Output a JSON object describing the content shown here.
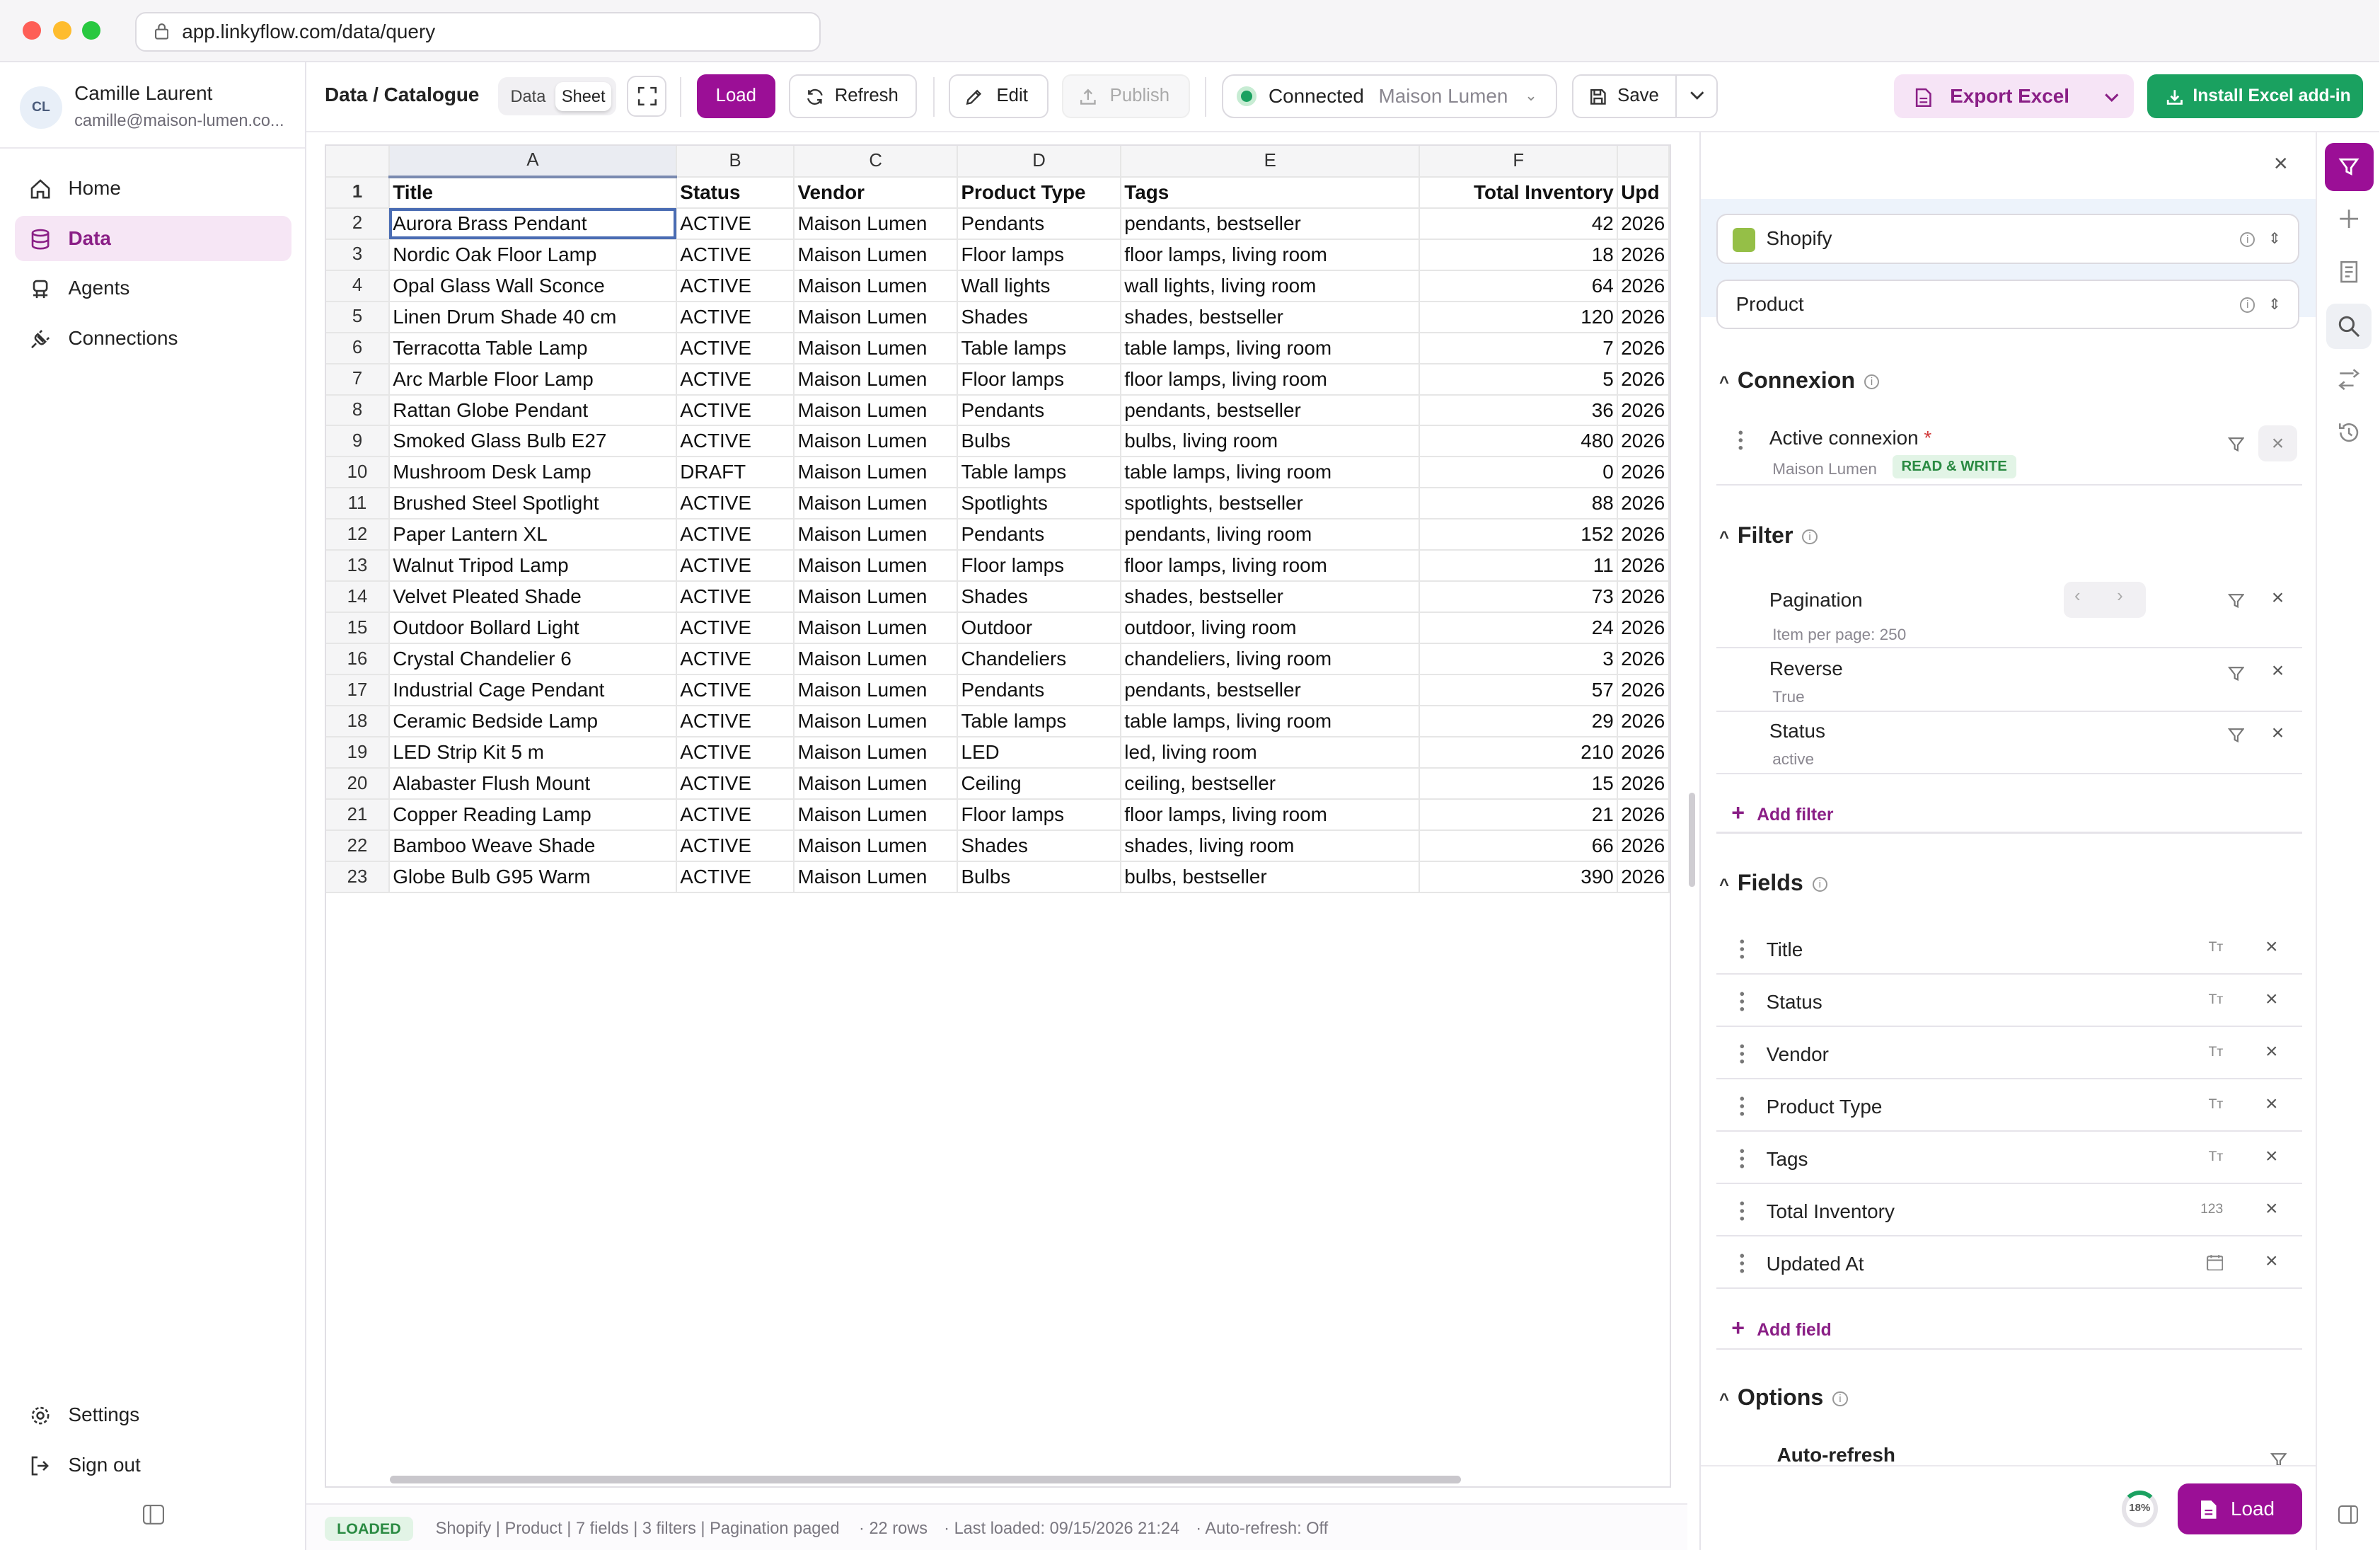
{
  "browser": {
    "url": "app.linkyflow.com/data/query"
  },
  "user": {
    "initials": "CL",
    "name": "Camille Laurent",
    "email": "camille@maison-lumen.co..."
  },
  "nav": {
    "home": "Home",
    "data": "Data",
    "agents": "Agents",
    "connections": "Connections",
    "settings": "Settings",
    "signout": "Sign out"
  },
  "toolbar": {
    "breadcrumb": "Data / Catalogue",
    "view_data": "Data",
    "view_sheet": "Sheet",
    "load": "Load",
    "refresh": "Refresh",
    "edit": "Edit",
    "publish": "Publish",
    "connection_status": "Connected",
    "connection_name": "Maison Lumen",
    "save": "Save",
    "export": "Export Excel",
    "install": "Install Excel add-in"
  },
  "sheet": {
    "columns": [
      "A",
      "B",
      "C",
      "D",
      "E",
      "F"
    ],
    "headers": [
      "Title",
      "Status",
      "Vendor",
      "Product Type",
      "Tags",
      "Total Inventory",
      "Upd"
    ],
    "rows": [
      [
        "Aurora Brass Pendant",
        "ACTIVE",
        "Maison Lumen",
        "Pendants",
        "pendants, bestseller",
        "42",
        "2026"
      ],
      [
        "Nordic Oak Floor Lamp",
        "ACTIVE",
        "Maison Lumen",
        "Floor lamps",
        "floor lamps, living room",
        "18",
        "2026"
      ],
      [
        "Opal Glass Wall Sconce",
        "ACTIVE",
        "Maison Lumen",
        "Wall lights",
        "wall lights, living room",
        "64",
        "2026"
      ],
      [
        "Linen Drum Shade 40 cm",
        "ACTIVE",
        "Maison Lumen",
        "Shades",
        "shades, bestseller",
        "120",
        "2026"
      ],
      [
        "Terracotta Table Lamp",
        "ACTIVE",
        "Maison Lumen",
        "Table lamps",
        "table lamps, living room",
        "7",
        "2026"
      ],
      [
        "Arc Marble Floor Lamp",
        "ACTIVE",
        "Maison Lumen",
        "Floor lamps",
        "floor lamps, living room",
        "5",
        "2026"
      ],
      [
        "Rattan Globe Pendant",
        "ACTIVE",
        "Maison Lumen",
        "Pendants",
        "pendants, bestseller",
        "36",
        "2026"
      ],
      [
        "Smoked Glass Bulb E27",
        "ACTIVE",
        "Maison Lumen",
        "Bulbs",
        "bulbs, living room",
        "480",
        "2026"
      ],
      [
        "Mushroom Desk Lamp",
        "DRAFT",
        "Maison Lumen",
        "Table lamps",
        "table lamps, living room",
        "0",
        "2026"
      ],
      [
        "Brushed Steel Spotlight",
        "ACTIVE",
        "Maison Lumen",
        "Spotlights",
        "spotlights, bestseller",
        "88",
        "2026"
      ],
      [
        "Paper Lantern XL",
        "ACTIVE",
        "Maison Lumen",
        "Pendants",
        "pendants, living room",
        "152",
        "2026"
      ],
      [
        "Walnut Tripod Lamp",
        "ACTIVE",
        "Maison Lumen",
        "Floor lamps",
        "floor lamps, living room",
        "11",
        "2026"
      ],
      [
        "Velvet Pleated Shade",
        "ACTIVE",
        "Maison Lumen",
        "Shades",
        "shades, bestseller",
        "73",
        "2026"
      ],
      [
        "Outdoor Bollard Light",
        "ACTIVE",
        "Maison Lumen",
        "Outdoor",
        "outdoor, living room",
        "24",
        "2026"
      ],
      [
        "Crystal Chandelier 6",
        "ACTIVE",
        "Maison Lumen",
        "Chandeliers",
        "chandeliers, living room",
        "3",
        "2026"
      ],
      [
        "Industrial Cage Pendant",
        "ACTIVE",
        "Maison Lumen",
        "Pendants",
        "pendants, bestseller",
        "57",
        "2026"
      ],
      [
        "Ceramic Bedside Lamp",
        "ACTIVE",
        "Maison Lumen",
        "Table lamps",
        "table lamps, living room",
        "29",
        "2026"
      ],
      [
        "LED Strip Kit 5 m",
        "ACTIVE",
        "Maison Lumen",
        "LED",
        "led, living room",
        "210",
        "2026"
      ],
      [
        "Alabaster Flush Mount",
        "ACTIVE",
        "Maison Lumen",
        "Ceiling",
        "ceiling, bestseller",
        "15",
        "2026"
      ],
      [
        "Copper Reading Lamp",
        "ACTIVE",
        "Maison Lumen",
        "Floor lamps",
        "floor lamps, living room",
        "21",
        "2026"
      ],
      [
        "Bamboo Weave Shade",
        "ACTIVE",
        "Maison Lumen",
        "Shades",
        "shades, living room",
        "66",
        "2026"
      ],
      [
        "Globe Bulb G95 Warm",
        "ACTIVE",
        "Maison Lumen",
        "Bulbs",
        "bulbs, bestseller",
        "390",
        "2026"
      ]
    ]
  },
  "status": {
    "badge": "LOADED",
    "summary": "Shopify | Product | 7 fields | 3 filters | Pagination paged",
    "rows": "· 22 rows",
    "last_loaded": "· Last loaded: 09/15/2026 21:24",
    "auto_refresh": "· Auto-refresh: Off"
  },
  "panel": {
    "source": "Shopify",
    "object": "Product",
    "connexion": {
      "title": "Connexion",
      "label": "Active connexion",
      "required": "*",
      "name": "Maison Lumen",
      "mode": "READ & WRITE"
    },
    "filter": {
      "title": "Filter",
      "items": [
        {
          "label": "Pagination",
          "value": "Item per page: 250"
        },
        {
          "label": "Reverse",
          "value": "True"
        },
        {
          "label": "Status",
          "value": "active"
        }
      ],
      "add": "Add filter"
    },
    "fields": {
      "title": "Fields",
      "items": [
        {
          "label": "Title",
          "type": "Tт"
        },
        {
          "label": "Status",
          "type": "Tт"
        },
        {
          "label": "Vendor",
          "type": "Tт"
        },
        {
          "label": "Product Type",
          "type": "Tт"
        },
        {
          "label": "Tags",
          "type": "Tт"
        },
        {
          "label": "Total Inventory",
          "type": "123"
        },
        {
          "label": "Updated At",
          "type": "calendar-icon"
        }
      ],
      "add": "Add field"
    },
    "options": {
      "title": "Options",
      "auto_refresh": "Auto-refresh"
    },
    "progress": "18%",
    "load": "Load"
  },
  "colors": {
    "accent": "#9b0f96",
    "success": "#1aa160",
    "active_nav_bg": "#f6e6f5"
  }
}
